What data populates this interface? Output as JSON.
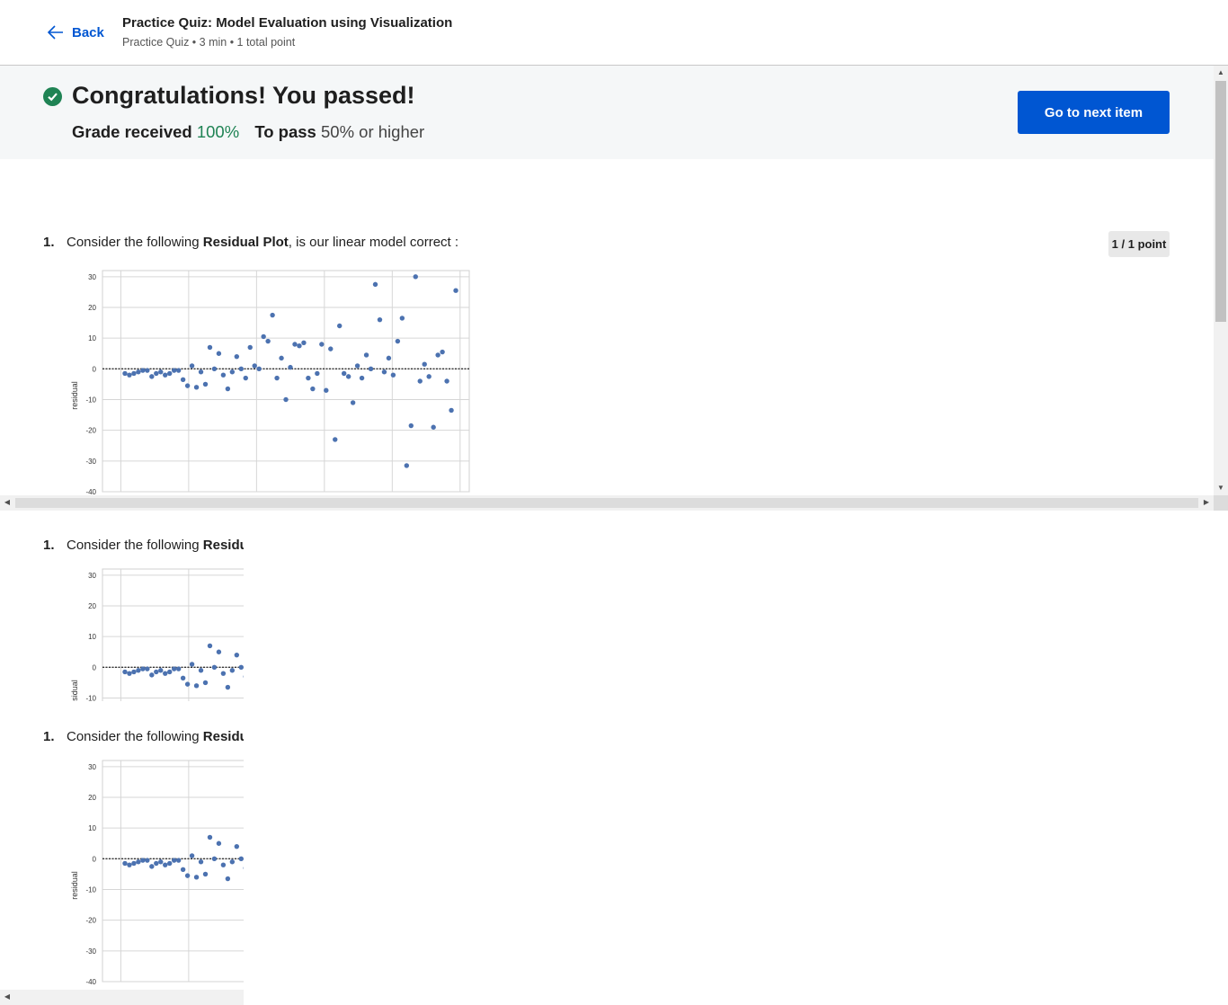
{
  "header": {
    "back_label": "Back",
    "title": "Practice Quiz: Model Evaluation using Visualization",
    "meta": "Practice Quiz • 3 min • 1 total point"
  },
  "result": {
    "headline": "Congratulations! You passed!",
    "grade_label": "Grade received",
    "grade_value": "100%",
    "pass_label": "To pass",
    "pass_value": "50% or higher",
    "next_button": "Go to next item"
  },
  "question": {
    "number": "1.",
    "text_before": "Consider the following ",
    "text_bold": "Residual Plot",
    "text_after": ", is our  linear model correct :",
    "points": "1 / 1 point"
  },
  "colors": {
    "accent": "#0056d2",
    "success": "#1f8354",
    "point": "#4c72b0"
  },
  "chart_data": {
    "type": "scatter",
    "ylabel": "residual",
    "ylim": [
      -40,
      32
    ],
    "yticks": [
      30,
      20,
      10,
      0,
      -10,
      -20,
      -30,
      -40
    ],
    "grid": true,
    "reference_line": 0,
    "series": [
      {
        "points": [
          [
            1,
            -1.5
          ],
          [
            2,
            -2
          ],
          [
            3,
            -1.5
          ],
          [
            4,
            -1
          ],
          [
            5,
            -0.5
          ],
          [
            6,
            -0.5
          ],
          [
            7,
            -2.5
          ],
          [
            8,
            -1.5
          ],
          [
            9,
            -1
          ],
          [
            10,
            -2
          ],
          [
            11,
            -1.5
          ],
          [
            12,
            -0.5
          ],
          [
            13,
            -0.5
          ],
          [
            14,
            -3.5
          ],
          [
            15,
            -5.5
          ],
          [
            16,
            1
          ],
          [
            17,
            -6
          ],
          [
            18,
            -1
          ],
          [
            19,
            -5
          ],
          [
            20,
            7
          ],
          [
            21,
            0
          ],
          [
            22,
            5
          ],
          [
            23,
            -2
          ],
          [
            24,
            -6.5
          ],
          [
            25,
            -1
          ],
          [
            26,
            4
          ],
          [
            27,
            0
          ],
          [
            28,
            -3
          ],
          [
            29,
            7
          ],
          [
            30,
            1
          ],
          [
            31,
            0
          ],
          [
            32,
            10.5
          ],
          [
            33,
            9
          ],
          [
            34,
            17.5
          ],
          [
            35,
            -3
          ],
          [
            36,
            3.5
          ],
          [
            37,
            -10
          ],
          [
            38,
            0.5
          ],
          [
            39,
            8
          ],
          [
            40,
            7.5
          ],
          [
            41,
            8.5
          ],
          [
            42,
            -3
          ],
          [
            43,
            -6.5
          ],
          [
            44,
            -1.5
          ],
          [
            45,
            8
          ],
          [
            46,
            -7
          ],
          [
            47,
            6.5
          ],
          [
            48,
            -23
          ],
          [
            49,
            14
          ],
          [
            50,
            -1.5
          ],
          [
            51,
            -2.5
          ],
          [
            52,
            -11
          ],
          [
            53,
            1
          ],
          [
            54,
            -3
          ],
          [
            55,
            4.5
          ],
          [
            56,
            0
          ],
          [
            57,
            27.5
          ],
          [
            58,
            16
          ],
          [
            59,
            -1
          ],
          [
            60,
            3.5
          ],
          [
            61,
            -2
          ],
          [
            62,
            9
          ],
          [
            63,
            16.5
          ],
          [
            64,
            -31.5
          ],
          [
            65,
            -18.5
          ],
          [
            66,
            30
          ],
          [
            67,
            -4
          ],
          [
            68,
            1.5
          ],
          [
            69,
            -2.5
          ],
          [
            70,
            -19
          ],
          [
            71,
            4.5
          ],
          [
            72,
            5.5
          ],
          [
            73,
            -4
          ],
          [
            74,
            -13.5
          ],
          [
            75,
            25.5
          ]
        ]
      }
    ]
  }
}
